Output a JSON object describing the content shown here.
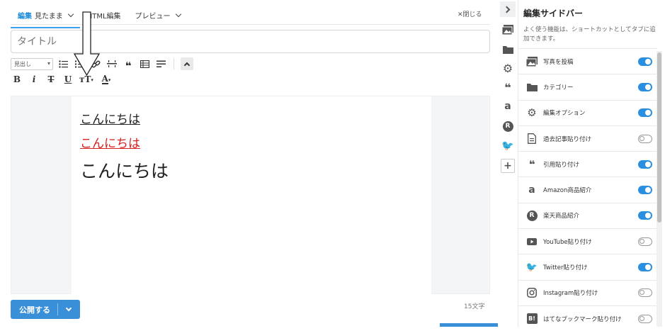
{
  "tabs": {
    "edit": {
      "label": "編集",
      "sub": "見たまま"
    },
    "html": {
      "label": "HTML編集"
    },
    "preview": {
      "label": "プレビュー"
    },
    "close": "閉じる"
  },
  "title_input": {
    "placeholder": "タイトル"
  },
  "toolbar": {
    "format_select": "見出し",
    "bold": "B",
    "italic": "i",
    "strike": "T",
    "underline": "U",
    "fontsize": "тT",
    "color": "A"
  },
  "content": {
    "lines": [
      "こんにちは",
      "こんにちは",
      "こんにちは"
    ],
    "colors": [
      "#222222",
      "#d81e1e",
      "#222222"
    ]
  },
  "footer": {
    "publish": "公開する",
    "char_count": "15文字"
  },
  "sidebar": {
    "title": "編集サイドバー",
    "description": "よく使う機能は、ショートカットとしてタブに追加できます。",
    "items": [
      {
        "label": "写真を投稿",
        "icon": "photo-icon",
        "enabled": true
      },
      {
        "label": "カテゴリー",
        "icon": "folder-icon",
        "enabled": true
      },
      {
        "label": "編集オプション",
        "icon": "gear-icon",
        "enabled": true
      },
      {
        "label": "過去記事貼り付け",
        "icon": "document-icon",
        "enabled": false
      },
      {
        "label": "引用貼り付け",
        "icon": "quote-icon",
        "enabled": true
      },
      {
        "label": "Amazon商品紹介",
        "icon": "amazon-icon",
        "enabled": true
      },
      {
        "label": "楽天商品紹介",
        "icon": "rakuten-icon",
        "enabled": true
      },
      {
        "label": "YouTube貼り付け",
        "icon": "youtube-icon",
        "enabled": false
      },
      {
        "label": "Twitter貼り付け",
        "icon": "twitter-icon",
        "enabled": true
      },
      {
        "label": "Instagram貼り付け",
        "icon": "instagram-icon",
        "enabled": false
      },
      {
        "label": "はてなブックマーク貼り付け",
        "icon": "hatena-bookmark-icon",
        "enabled": false
      }
    ]
  },
  "colors": {
    "accent": "#2a8fe0",
    "publish": "#3a8fd9",
    "red_text": "#d81e1e"
  }
}
